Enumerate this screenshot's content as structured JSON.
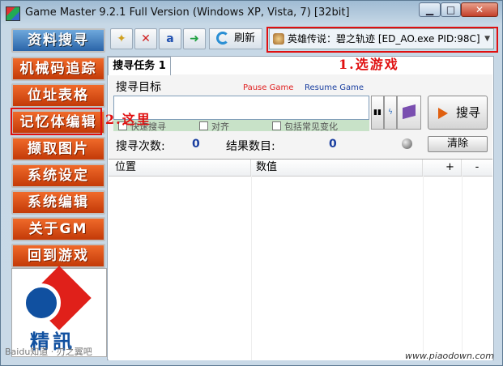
{
  "window": {
    "title": "Game Master 9.2.1 Full Version (Windows XP, Vista, 7) [32bit]",
    "min_label": "▁",
    "max_label": "□",
    "close_label": "✕"
  },
  "sidebar": {
    "items": [
      {
        "label": "资料搜寻",
        "style": "blue"
      },
      {
        "label": "机械码追踪"
      },
      {
        "label": "位址表格"
      },
      {
        "label": "记忆体编辑"
      },
      {
        "label": "撷取图片"
      },
      {
        "label": "系统设定"
      },
      {
        "label": "系统编辑"
      },
      {
        "label": "关于GM"
      },
      {
        "label": "回到游戏"
      }
    ],
    "logo_text": "精訊",
    "baidu_watermark": "Baidu知道 · 刃之翼吧"
  },
  "toolbar": {
    "refresh_label": "刷新",
    "process_label": "英雄传说：碧之轨迹 [ED_AO.exe PID:98C]",
    "icons": [
      "open-folder-icon",
      "delete-icon",
      "text-icon",
      "export-icon"
    ]
  },
  "tabs": [
    {
      "label": "搜寻任务 1"
    }
  ],
  "search": {
    "target_label": "搜寻目标",
    "pause_label": "Pause Game",
    "resume_label": "Resume Game",
    "input_value": "",
    "button_label": "搜寻",
    "options": [
      {
        "label": "快速搜寻"
      },
      {
        "label": "对齐"
      },
      {
        "label": "包括常见变化"
      }
    ],
    "count_label": "搜寻次数:",
    "count_value": "0",
    "results_label": "结果数目:",
    "results_value": "0",
    "clear_label": "清除"
  },
  "results_table": {
    "columns": [
      "位置",
      "数值",
      "+",
      "-"
    ]
  },
  "annotations": {
    "select_game": "1.选游戏",
    "here": "2.这里"
  },
  "watermark": "www.piaodown.com",
  "colors": {
    "sidebar_orange": "#e0501a",
    "sidebar_blue": "#3a78bc",
    "annotation_red": "#e01010",
    "stat_blue": "#1a3fa0"
  }
}
